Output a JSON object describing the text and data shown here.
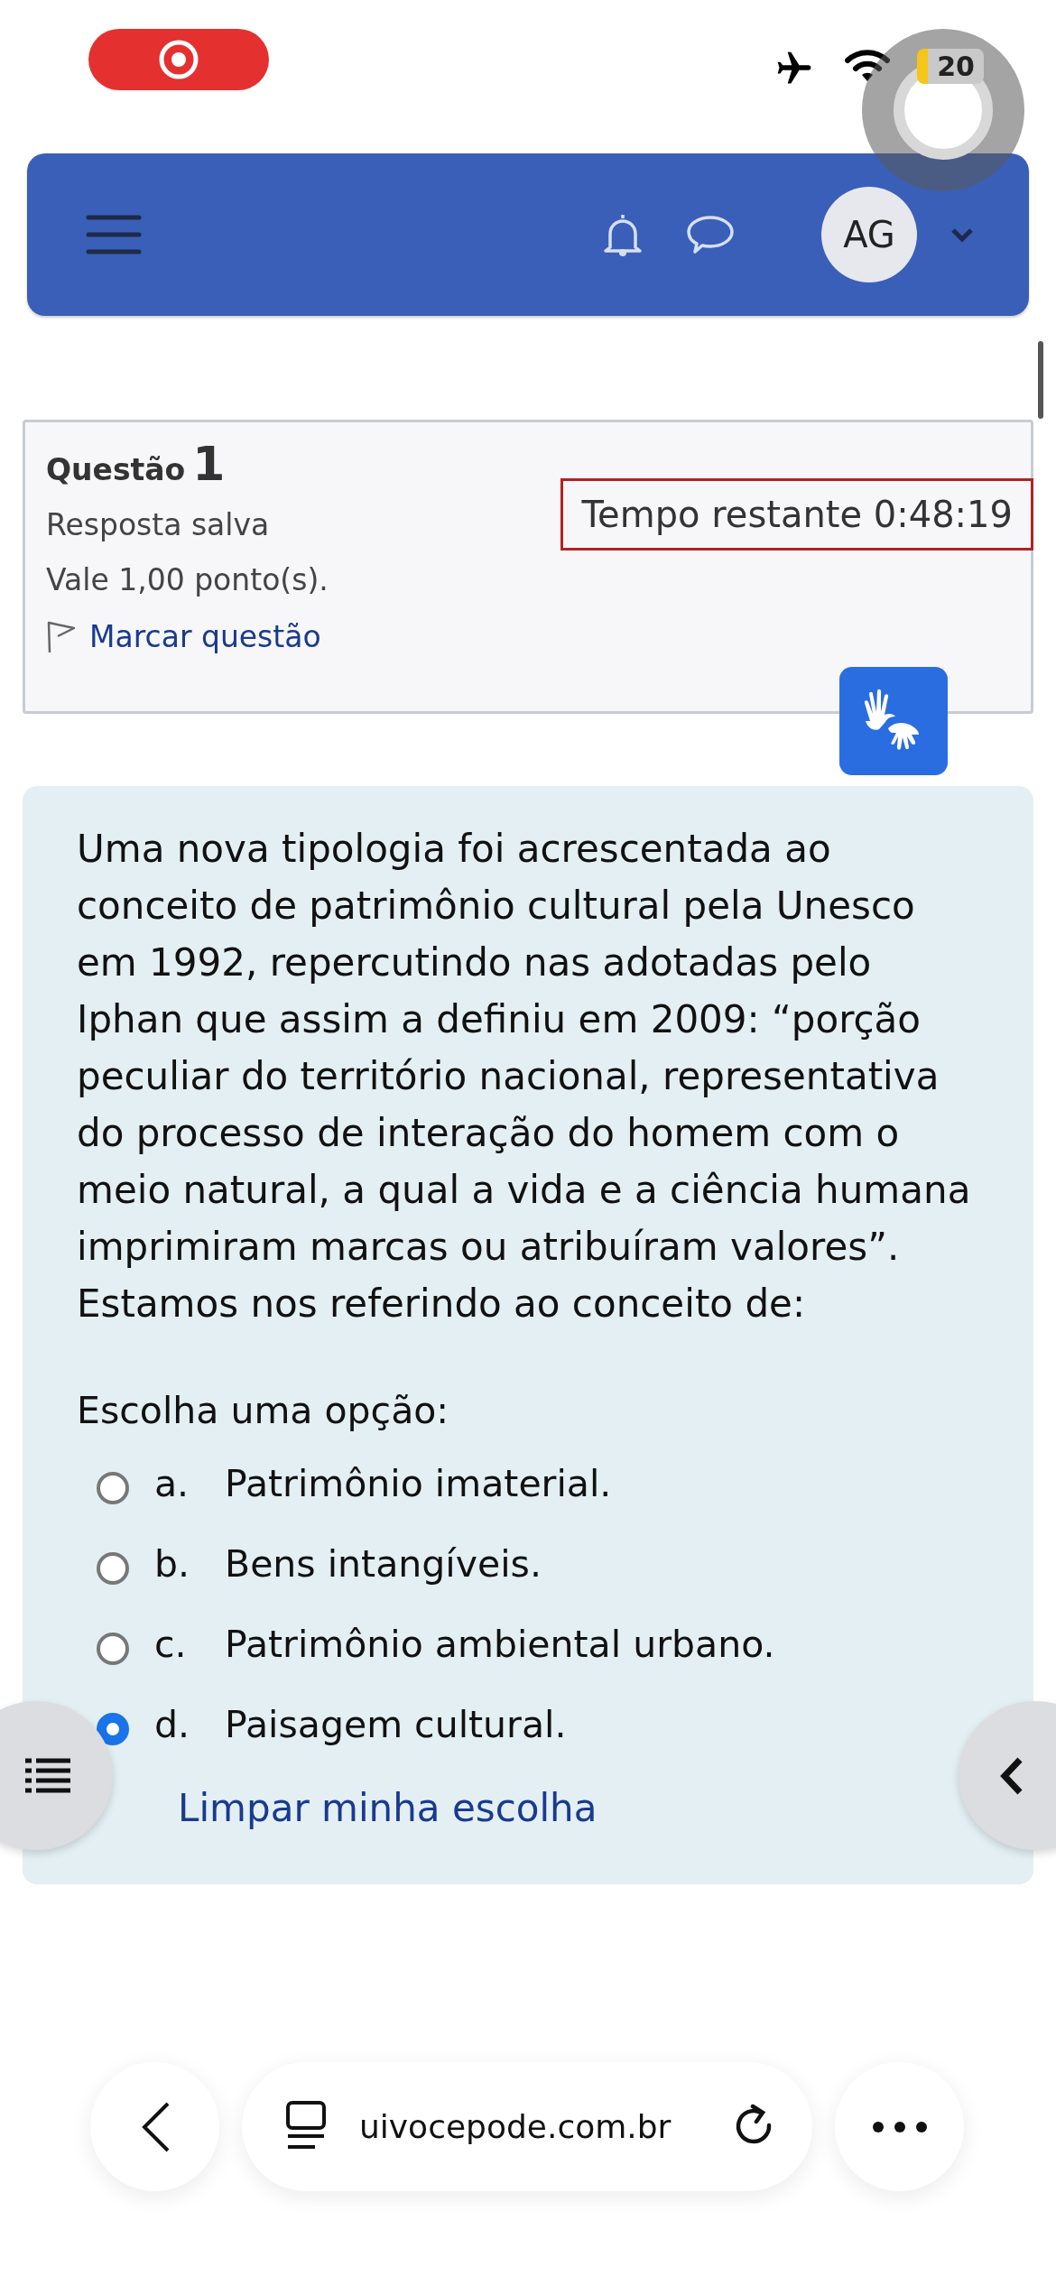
{
  "status_bar": {
    "battery": "20"
  },
  "navbar": {
    "avatar": "AG"
  },
  "question_info": {
    "label": "Questão",
    "number": "1",
    "state": "Resposta salva",
    "grade": "Vale 1,00 ponto(s).",
    "flag_link": "Marcar questão",
    "timer": "Tempo restante 0:48:19"
  },
  "question": {
    "text": "Uma nova tipologia foi acrescentada ao conceito de patrimônio cultural pela Unesco em 1992, repercutindo nas adotadas pelo Iphan que assim a definiu em 2009: “porção peculiar do território nacional, representativa do processo de interação do homem com o meio natural, a qual a vida e a ciência humana imprimiram marcas ou atribuíram valores”. Estamos nos referindo ao conceito de:",
    "prompt": "Escolha uma opção:",
    "options": [
      {
        "letter": "a.",
        "text": "Patrimônio imaterial.",
        "selected": false
      },
      {
        "letter": "b.",
        "text": "Bens intangíveis.",
        "selected": false
      },
      {
        "letter": "c.",
        "text": "Patrimônio ambiental urbano.",
        "selected": false
      },
      {
        "letter": "d.",
        "text": "Paisagem cultural.",
        "selected": true
      }
    ],
    "clear_link": "Limpar minha escolha"
  },
  "browser_bar": {
    "url": "uivocepode.com.br"
  }
}
